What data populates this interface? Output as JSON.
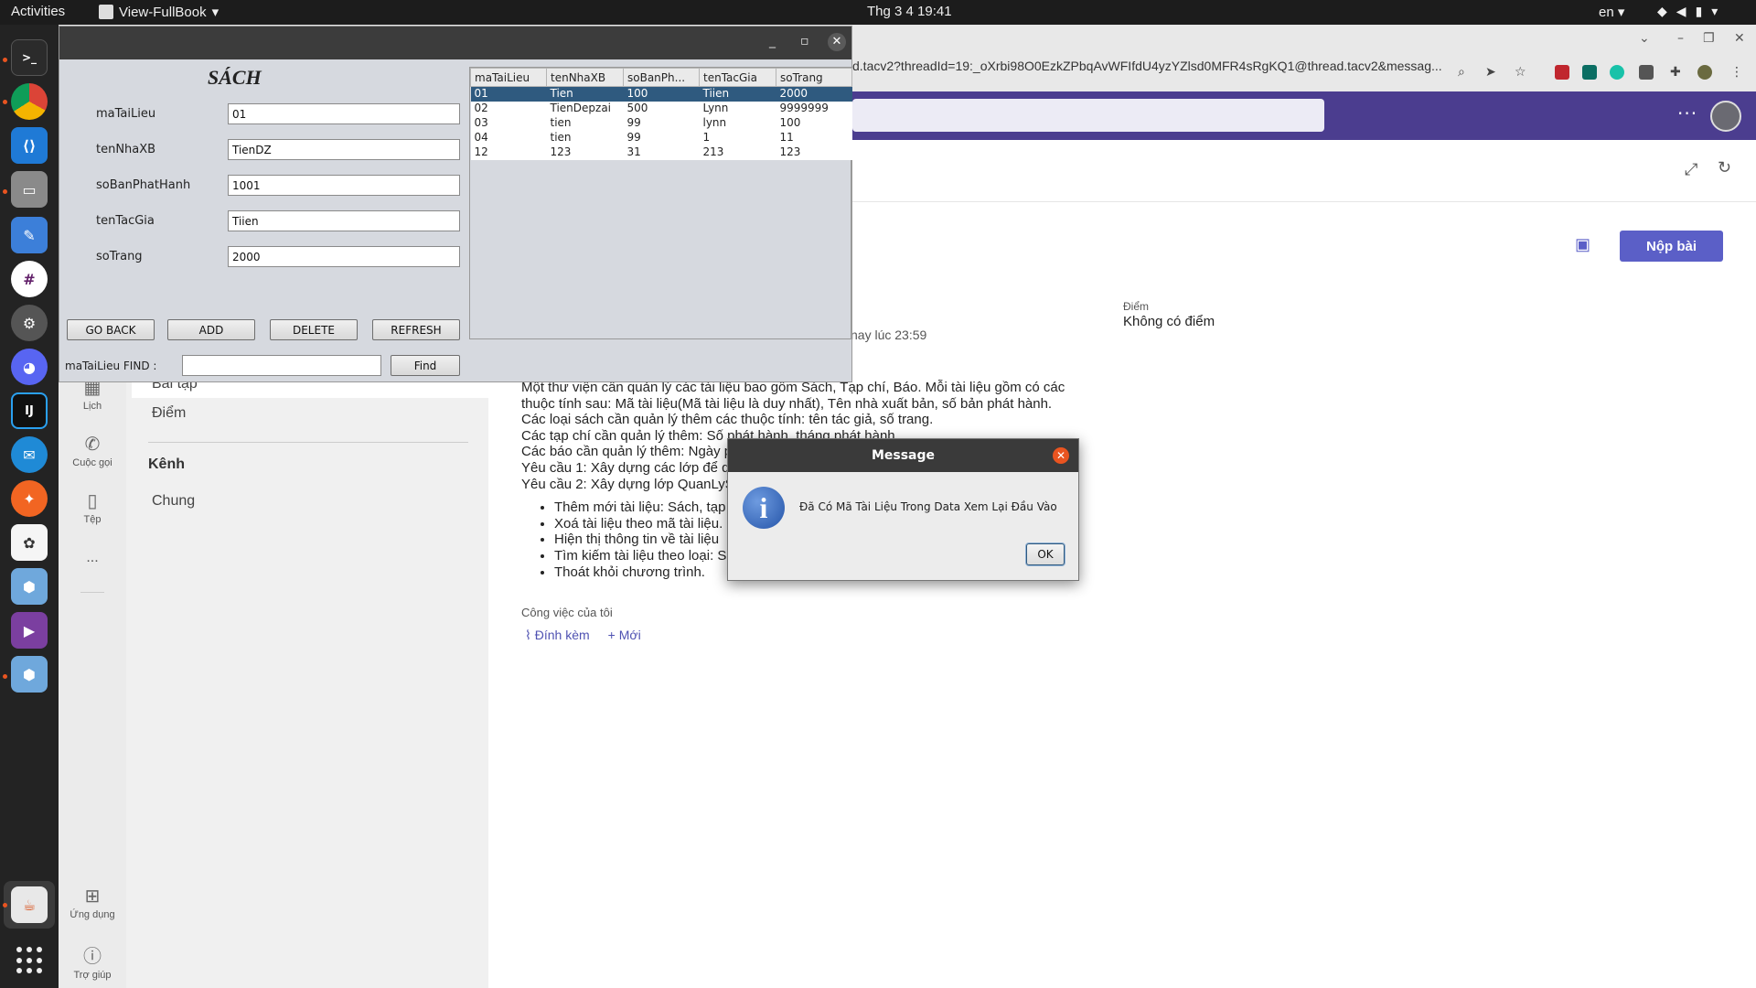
{
  "topbar": {
    "activities": "Activities",
    "app_menu": "View-FullBook",
    "clock": "Thg 3 4  19:41",
    "lang": "en"
  },
  "browser": {
    "address": "d.tacv2?threadId=19:_oXrbi98O0EzkZPbqAvWFIfdU4yzYZlsd0MFR4sRgKQ1@thread.tacv2&messag..."
  },
  "teams": {
    "rail": [
      {
        "icon": "calendar-icon",
        "label": "Lịch"
      },
      {
        "icon": "phone-icon",
        "label": "Cuộc gọi"
      },
      {
        "icon": "file-icon",
        "label": "Tệp"
      },
      {
        "icon": "more-icon",
        "label": "..."
      },
      {
        "icon": "apps-icon",
        "label": "Ứng dụng"
      },
      {
        "icon": "help-icon",
        "label": "Trợ giúp"
      }
    ],
    "list": {
      "bai_tap": "Bài tập",
      "diem": "Điểm",
      "kenh": "Kênh",
      "chung": "Chung"
    },
    "main": {
      "submit_button": "Nộp bài",
      "diem_label": "Điểm",
      "diem_value": "Không có điểm",
      "due": "nay lúc 23:59",
      "description_lines": [
        "Một thư viện cần quản lý các tài liệu bao gồm Sách, Tạp chí, Báo. Mỗi tài liệu gồm có các",
        "thuộc tính sau: Mã tài liệu(Mã tài liệu là duy nhất), Tên nhà xuất bản, số bản phát hành.",
        "Các loại sách cần quản lý thêm các thuộc tính: tên tác giả, số trang.",
        "Các tạp chí cần quản lý thêm: Số phát hành, tháng phát hành.",
        "Các báo cần quản lý thêm: Ngày p",
        "Yêu cầu 1: Xây dựng các lớp để q",
        "Yêu cầu 2: Xây dựng lớp QuanLyS"
      ],
      "bullets": [
        "Thêm mới tài liệu: Sách, tạp",
        "Xoá tài liệu theo mã tài liệu.",
        "Hiện thị thông tin về tài liệu",
        "Tìm kiếm tài liệu theo loại: S",
        "Thoát khỏi chương trình."
      ],
      "my_work": "Công việc của tôi",
      "attach": "Đính kèm",
      "new": "Mới"
    }
  },
  "java_window": {
    "title": "SÁCH",
    "fields": [
      {
        "label": "maTaiLieu",
        "value": "01"
      },
      {
        "label": "tenNhaXB",
        "value": "TienDZ"
      },
      {
        "label": "soBanPhatHanh",
        "value": "1001"
      },
      {
        "label": "tenTacGia",
        "value": "Tiien"
      },
      {
        "label": "soTrang",
        "value": "2000"
      }
    ],
    "buttons": {
      "go_back": "GO BACK",
      "add": "ADD",
      "delete": "DELETE",
      "refresh": "REFRESH",
      "find": "Find"
    },
    "find_label": "maTaiLieu FIND :",
    "find_value": "",
    "table": {
      "columns": [
        "maTaiLieu",
        "tenNhaXB",
        "soBanPh...",
        "tenTacGia",
        "soTrang"
      ],
      "rows": [
        [
          "01",
          "Tien",
          "100",
          "Tiien",
          "2000"
        ],
        [
          "02",
          "TienDepzai",
          "500",
          "Lynn",
          "9999999"
        ],
        [
          "03",
          "tien",
          "99",
          "lynn",
          "100"
        ],
        [
          "04",
          "tien",
          "99",
          "1",
          "11"
        ],
        [
          "12",
          "123",
          "31",
          "213",
          "123"
        ]
      ],
      "selected_row": 0
    }
  },
  "dialog": {
    "title": "Message",
    "message": "Đã Có Mã Tài Liệu Trong Data Xem Lại Đầu Vào",
    "ok": "OK"
  },
  "colors": {
    "teams_purple": "#4b3d8f",
    "teams_button": "#5b5fc7",
    "selection_blue": "#2f5a7f",
    "ubuntu_orange": "#e95420"
  }
}
